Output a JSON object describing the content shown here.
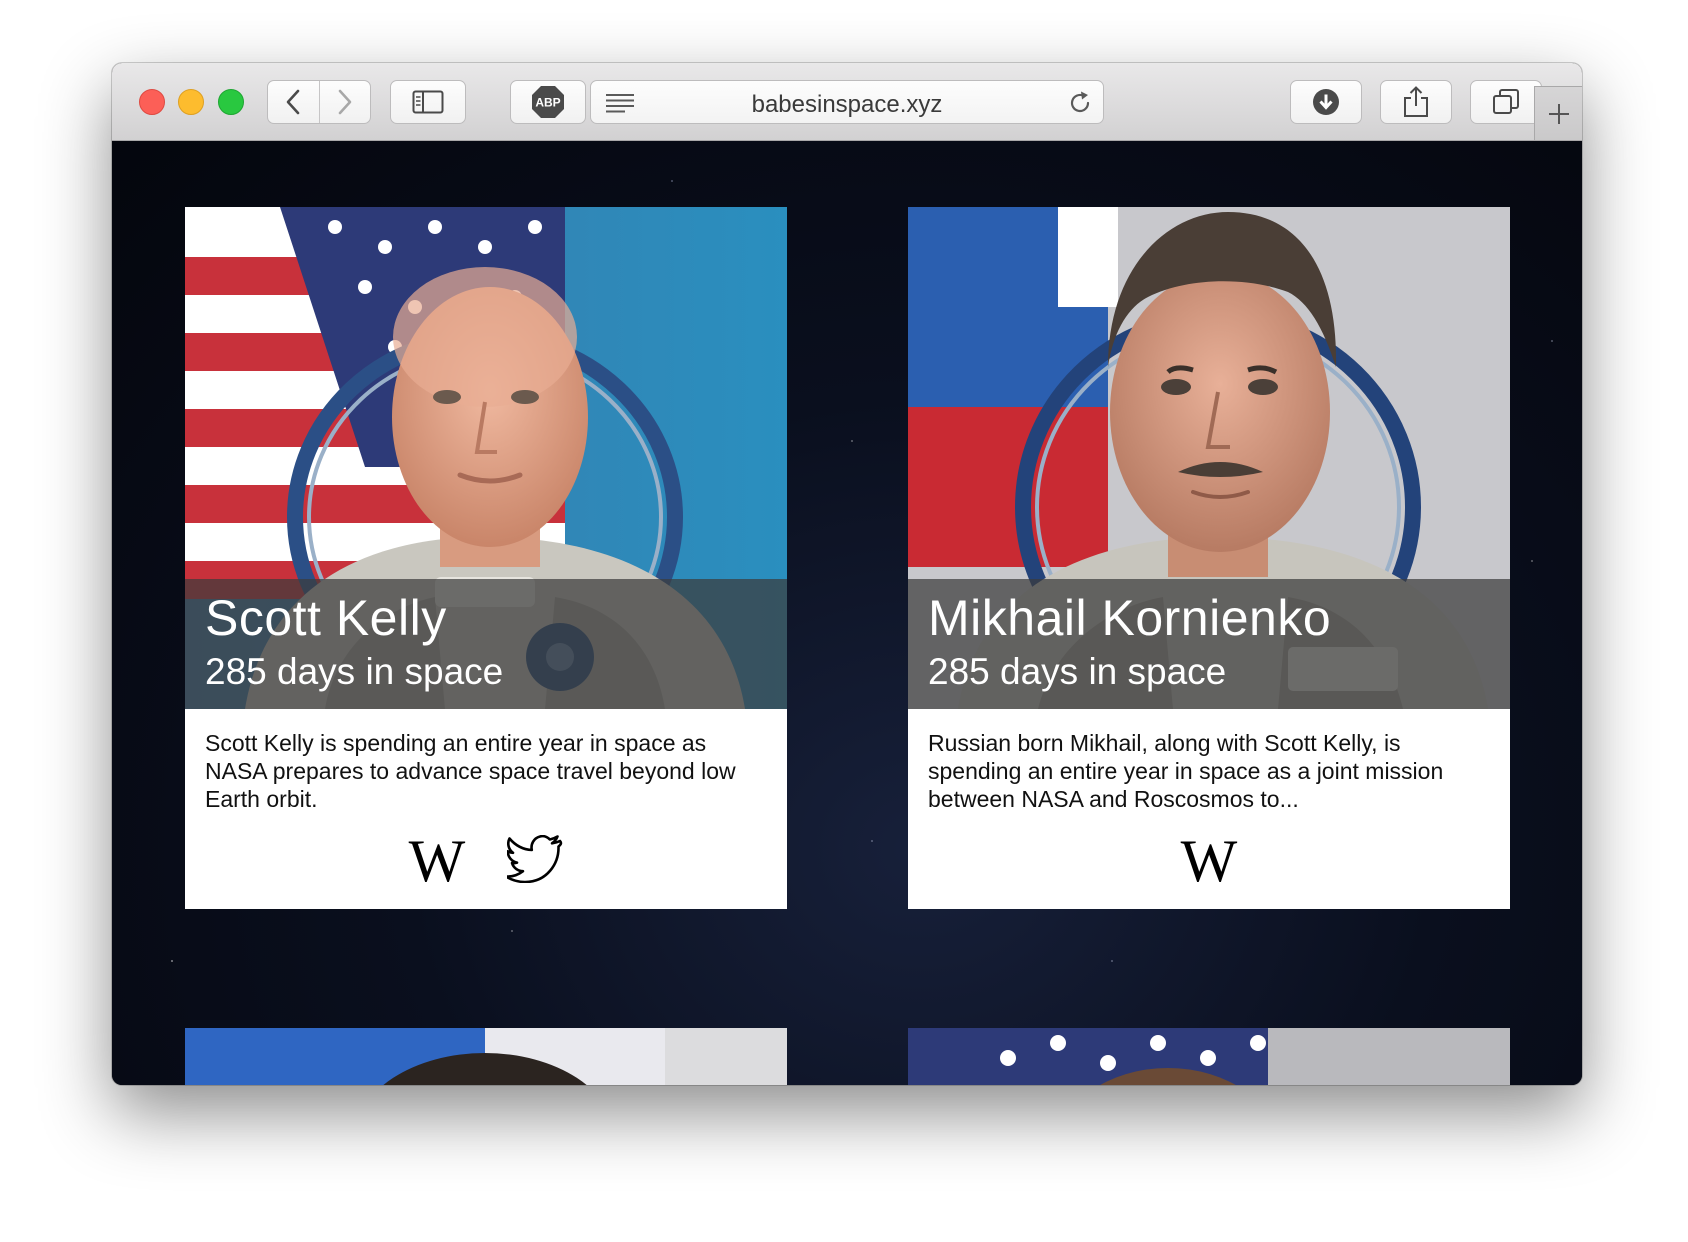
{
  "browser": {
    "url": "babesinspace.xyz",
    "icons": {
      "back": "chevron-left-icon",
      "forward": "chevron-right-icon",
      "sidebar": "sidebar-icon",
      "adblock": "abp-icon",
      "reader": "reader-icon",
      "reload": "reload-icon",
      "downloads": "download-icon",
      "share": "share-icon",
      "tabs": "tabs-icon",
      "new_tab": "plus-icon"
    },
    "adblock_label": "ABP"
  },
  "cards": [
    {
      "name": "Scott Kelly",
      "days": "285 days in space",
      "description": "Scott Kelly is spending an entire year in space as NASA prepares to advance space travel beyond low Earth orbit.",
      "links": [
        "wikipedia",
        "twitter"
      ]
    },
    {
      "name": "Mikhail Kornienko",
      "days": "285 days in space",
      "description": "Russian born Mikhail, along with Scott Kelly, is spending an entire year in space as a joint mission between NASA and Roscosmos to...",
      "links": [
        "wikipedia"
      ]
    }
  ],
  "wiki_glyph": "W",
  "colors": {
    "background": "#05070f",
    "caption_overlay": "rgba(60,60,60,0.72)",
    "card": "#ffffff"
  }
}
